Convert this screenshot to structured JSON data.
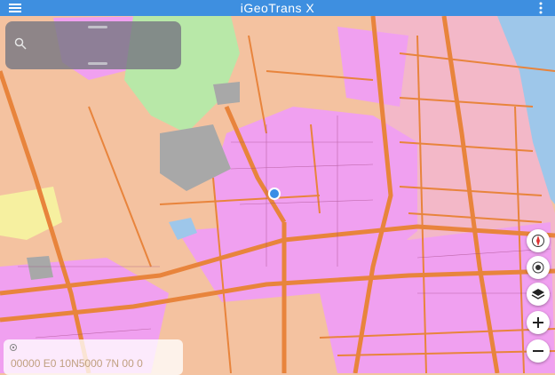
{
  "app": {
    "title": "iGeoTrans X"
  },
  "search": {
    "placeholder": ""
  },
  "controls": {
    "compass": "compass-icon",
    "gps": "gps-toggle-icon",
    "layers": "layers-icon",
    "zoom_in": "+",
    "zoom_out": "−"
  },
  "coordinates": {
    "text": "00000 E0  10N5000 7N  00 0"
  },
  "colors": {
    "topbar": "#3e8fe0",
    "residential": "#f0a0f0",
    "urban_pink": "#f3b8c8",
    "land_orange": "#f4c2a0",
    "roads": "#e8843c",
    "green": "#b8e8a8",
    "gray": "#a8a8a8",
    "location_dot": "#3a8ee6"
  }
}
